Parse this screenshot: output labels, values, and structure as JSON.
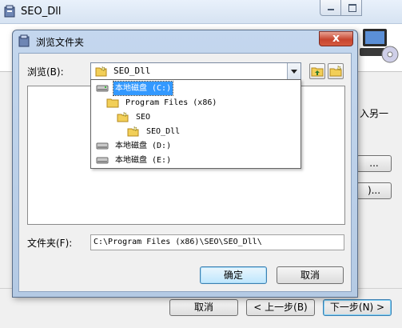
{
  "wizard": {
    "title": "SEO_Dll",
    "side_text": "入另一",
    "partial_button_1": "...",
    "partial_button_2": ")...",
    "buttons": {
      "cancel": "取消",
      "back": "< 上一步(B)",
      "next": "下一步(N) >"
    }
  },
  "dialog": {
    "title": "浏览文件夹",
    "close_symbol": "x",
    "browse_label": "浏览(B):",
    "combo_value": "SEO_Dll",
    "folder_label": "文件夹(F):",
    "folder_path": "C:\\Program Files (x86)\\SEO\\SEO_Dll\\",
    "ok_label": "确定",
    "cancel_label": "取消"
  },
  "dropdown": {
    "items": [
      {
        "label": "本地磁盘 (C:)",
        "icon": "drive-icon",
        "selected": true
      },
      {
        "label": "Program Files (x86)",
        "icon": "folder-icon",
        "selected": false
      },
      {
        "label": "SEO",
        "icon": "folder-open-icon",
        "selected": false
      },
      {
        "label": "SEO_Dll",
        "icon": "folder-open-icon",
        "selected": false
      },
      {
        "label": "本地磁盘 (D:)",
        "icon": "drive-icon",
        "selected": false
      },
      {
        "label": "本地磁盘 (E:)",
        "icon": "drive-icon",
        "selected": false
      }
    ]
  },
  "colors": {
    "selection": "#3399ff",
    "close_button": "#c7452f",
    "dialog_frame": "#b4cae4",
    "folder": "#f2cf58"
  }
}
